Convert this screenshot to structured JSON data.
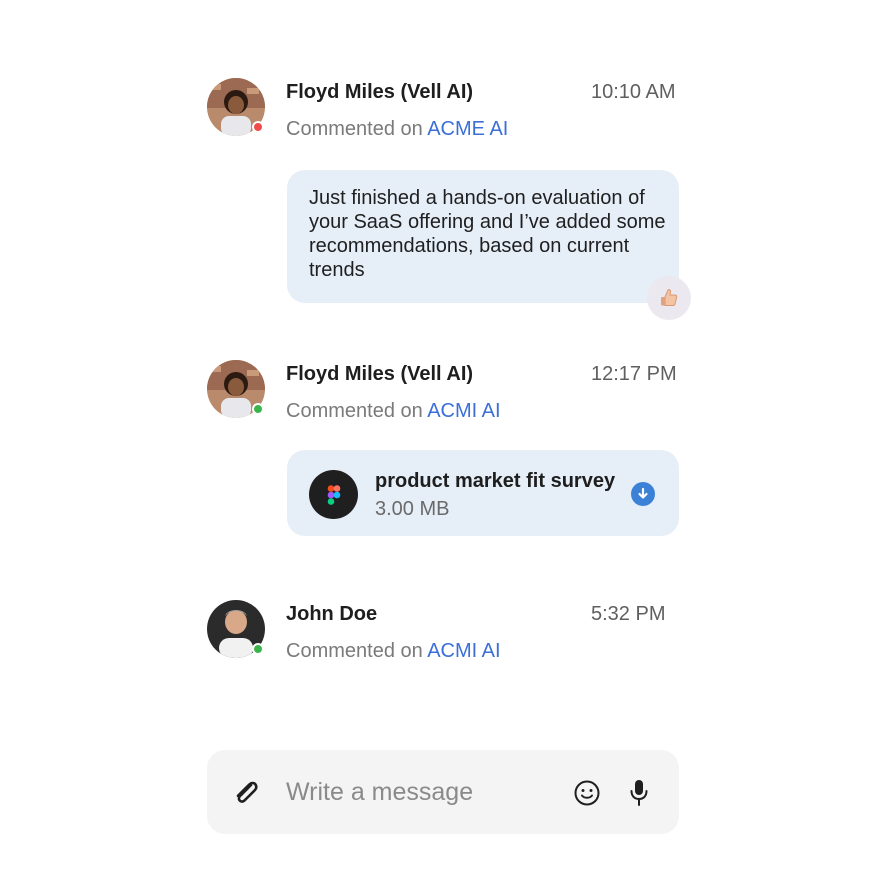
{
  "comments": [
    {
      "author": "Floyd Miles (Vell AI)",
      "time": "10:10 AM",
      "prefix": "Commented on",
      "target": "ACME AI",
      "status_color": "#f04a4a",
      "message": "Just finished a hands-on evaluation of your SaaS offering and I’ve added some recommendations, based on current trends",
      "reaction_icon": "thumbs-up-icon"
    },
    {
      "author": "Floyd Miles (Vell AI)",
      "time": "12:17 PM",
      "prefix": "Commented on",
      "target": "ACMI AI",
      "status_color": "#3bb54a",
      "attachment": {
        "name": "product market fit survey",
        "size": "3.00 MB",
        "icon": "figma-icon"
      }
    },
    {
      "author": "John Doe",
      "time": "5:32 PM",
      "prefix": "Commented on",
      "target": "ACMI AI",
      "status_color": "#3bb54a"
    }
  ],
  "composer": {
    "placeholder": "Write a message",
    "value": ""
  },
  "colors": {
    "bubble": "#e6eef8",
    "link": "#3b6fd6",
    "download": "#3b82d6",
    "composer_bg": "#f4f4f4"
  }
}
